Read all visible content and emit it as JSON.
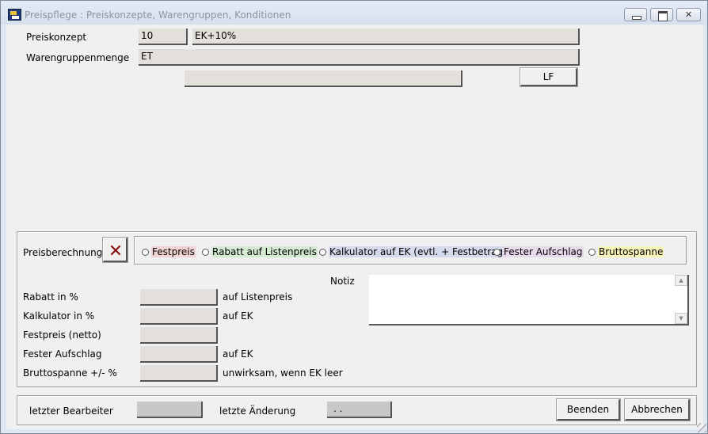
{
  "window": {
    "title": "Preispflege : Preiskonzepte, Warengruppen, Konditionen"
  },
  "header": {
    "preiskonzept_label": "Preiskonzept",
    "preiskonzept_code": "10",
    "preiskonzept_name": "EK+10%",
    "warengruppenmenge_label": "Warengruppenmenge",
    "warengruppenmenge_value": "ET",
    "extra_field_value": "",
    "lf_button": "LF"
  },
  "pricing": {
    "preisberechnung_label": "Preisberechnung",
    "clear_icon": "close-x-icon",
    "options": [
      {
        "label": "Festpreis",
        "color": "#f2d4d4",
        "selected": false
      },
      {
        "label": "Rabatt auf Listenpreis",
        "color": "#d5ead3",
        "selected": false
      },
      {
        "label": "Kalkulator auf EK (evtl. + Festbetrag)",
        "color": "#d4d9ec",
        "selected": false
      },
      {
        "label": "Fester Aufschlag",
        "color": "#e9d9ec",
        "selected": false
      },
      {
        "label": "Bruttospanne",
        "color": "#f7f2b8",
        "selected": false
      }
    ],
    "notiz_label": "Notiz",
    "notiz_value": "",
    "rows": [
      {
        "label": "Rabatt in %",
        "value": "",
        "suffix": "auf Listenpreis"
      },
      {
        "label": "Kalkulator in %",
        "value": "",
        "suffix": "auf EK"
      },
      {
        "label": "Festpreis (netto)",
        "value": "",
        "suffix": ""
      },
      {
        "label": "Fester Aufschlag",
        "value": "",
        "suffix": "auf EK"
      },
      {
        "label": "Bruttospanne +/- %",
        "value": "",
        "suffix": "unwirksam, wenn EK leer"
      }
    ]
  },
  "footer": {
    "letzter_bearbeiter_label": "letzter Bearbeiter",
    "letzter_bearbeiter_value": "",
    "letzte_aenderung_label": "letzte Änderung",
    "letzte_aenderung_value": ". .",
    "beenden_button": "Beenden",
    "abbrechen_button": "Abbrechen"
  },
  "colors": {
    "window_frame": "#dfe7f1",
    "client_bg": "#f0f0f0",
    "field_bg": "#e3dfdb",
    "clear_icon_color": "#8b1010"
  }
}
